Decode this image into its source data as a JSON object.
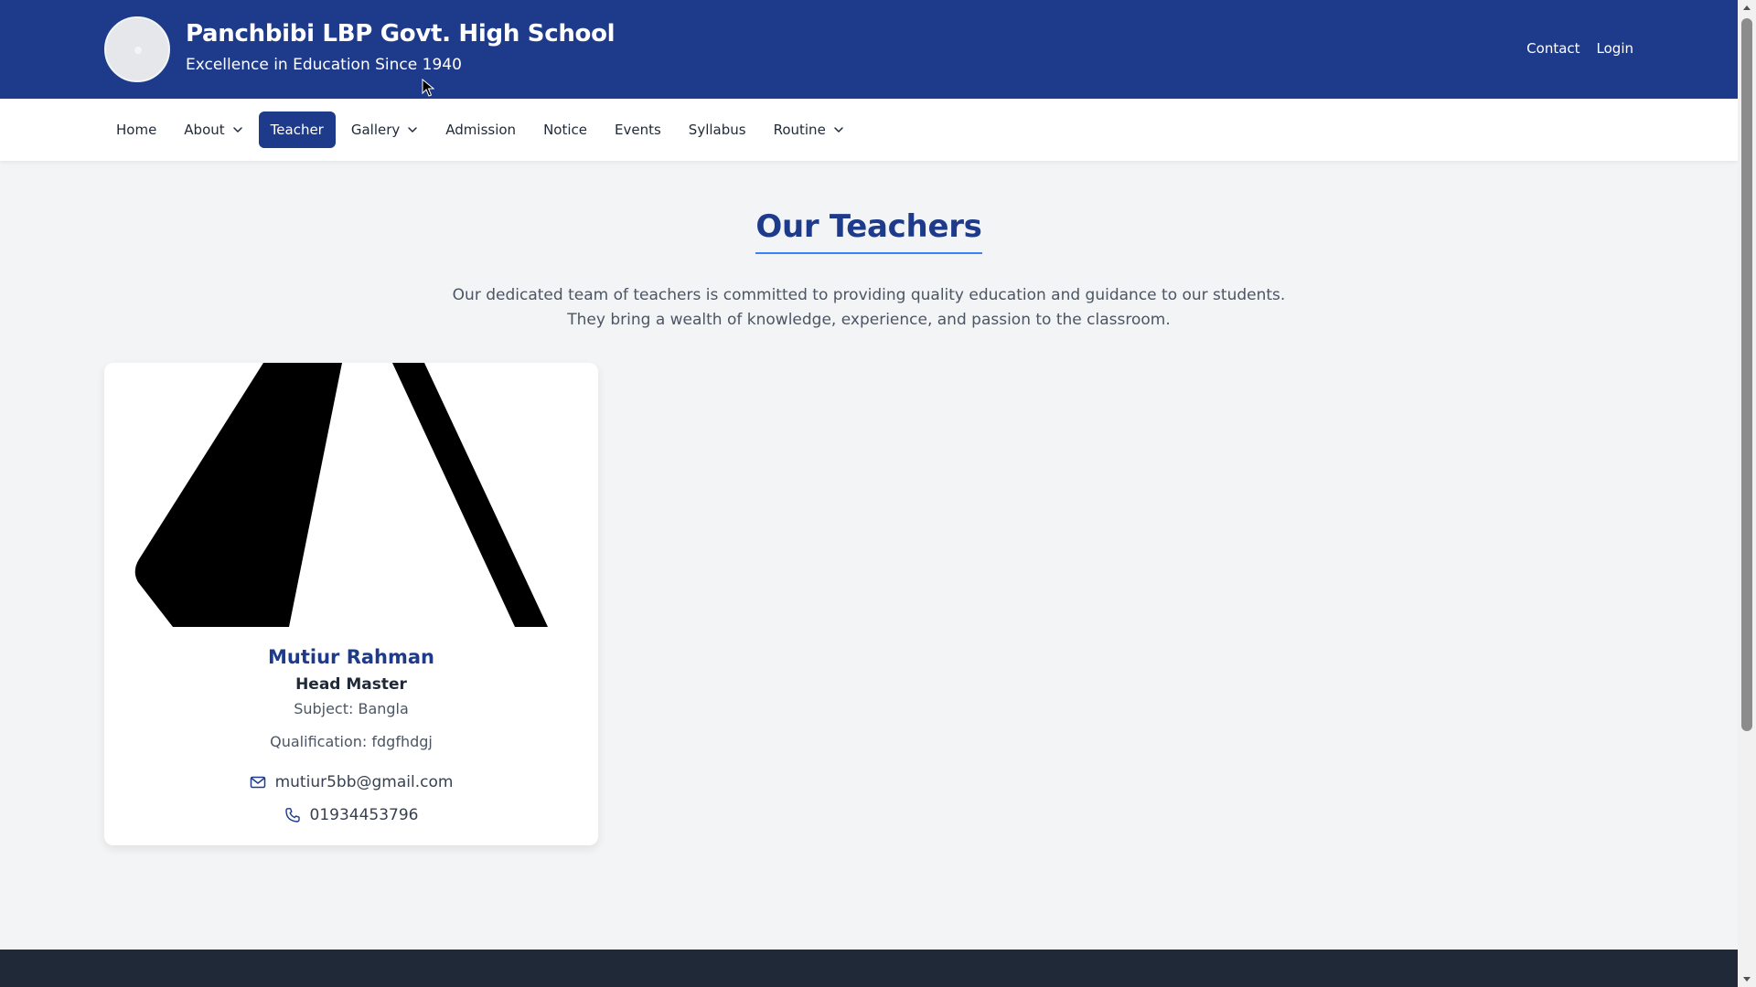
{
  "header": {
    "school_name": "Panchbibi LBP Govt. High School",
    "tagline": "Excellence in Education Since 1940",
    "links": [
      {
        "label": "Contact"
      },
      {
        "label": "Login"
      }
    ]
  },
  "nav": {
    "items": [
      {
        "label": "Home",
        "dropdown": false,
        "active": false
      },
      {
        "label": "About",
        "dropdown": true,
        "active": false
      },
      {
        "label": "Teacher",
        "dropdown": false,
        "active": true
      },
      {
        "label": "Gallery",
        "dropdown": true,
        "active": false
      },
      {
        "label": "Admission",
        "dropdown": false,
        "active": false
      },
      {
        "label": "Notice",
        "dropdown": false,
        "active": false
      },
      {
        "label": "Events",
        "dropdown": false,
        "active": false
      },
      {
        "label": "Syllabus",
        "dropdown": false,
        "active": false
      },
      {
        "label": "Routine",
        "dropdown": true,
        "active": false
      }
    ]
  },
  "page": {
    "title": "Our Teachers",
    "intro_line1": "Our dedicated team of teachers is committed to providing quality education and guidance to our students.",
    "intro_line2": "They bring a wealth of knowledge, experience, and passion to the classroom."
  },
  "teachers": [
    {
      "name": "Mutiur Rahman",
      "role": "Head Master",
      "subject": "Subject: Bangla",
      "qualification": "Qualification: fdgfhdgj",
      "email": "mutiur5bb@gmail.com",
      "phone": "01934453796",
      "icons": {
        "email": "mail-icon",
        "phone": "phone-icon"
      }
    }
  ],
  "colors": {
    "primary": "#1e3a8a",
    "accent_underline": "#3b82f6",
    "background": "#f3f4f6",
    "footer": "#1f2937"
  }
}
